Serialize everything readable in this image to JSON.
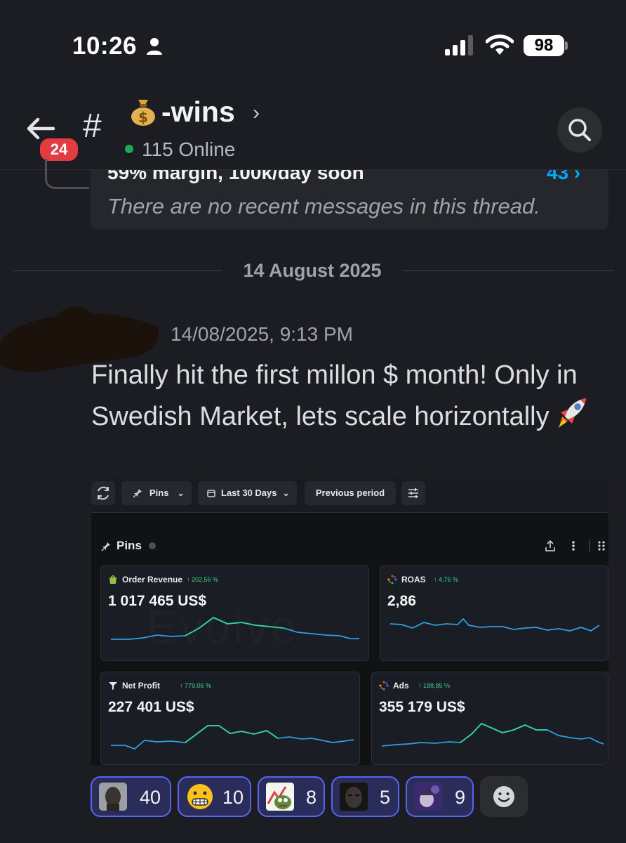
{
  "status_bar": {
    "time": "10:26",
    "battery": "98"
  },
  "header": {
    "back_badge": "24",
    "hash": "#",
    "channel_name": "-wins",
    "online": "115 Online"
  },
  "thread": {
    "title": "59% margin, 100k/day soon",
    "count": "43 ›",
    "empty_text": "There are no recent messages in this thread."
  },
  "date_divider": "14 August 2025",
  "message": {
    "timestamp": "14/08/2025, 9:13 PM",
    "text": "Finally hit the first millon $ month! Only in Swedish Market, lets scale horizontally"
  },
  "dashboard": {
    "toolbar": {
      "pins": "Pins",
      "range": "Last 30 Days",
      "compare": "Previous period"
    },
    "section_title": "Pins",
    "watermark": "Evolve",
    "cards": [
      {
        "title": "Order Revenue",
        "change": "↑ 202,56 %",
        "value": "1 017 465 US$"
      },
      {
        "title": "ROAS",
        "change": "↑ 4,76 %",
        "value": "2,86"
      },
      {
        "title": "Net Profit",
        "change": "↑ 779,06 %",
        "value": "227 401 US$"
      },
      {
        "title": "Ads",
        "change": "↑ 188,85 %",
        "value": "355 179 US$"
      }
    ]
  },
  "reactions": [
    {
      "count": "40",
      "icon": "avatar-face-icon"
    },
    {
      "count": "10",
      "icon": "grimace-emoji-icon"
    },
    {
      "count": "8",
      "icon": "pepe-chart-icon"
    },
    {
      "count": "5",
      "icon": "dark-face-icon"
    },
    {
      "count": "9",
      "icon": "anime-face-icon"
    }
  ],
  "colors": {
    "background": "#1c1d22",
    "accent_blue": "#00a8fc",
    "online_green": "#23a55a",
    "badge_red": "#e23b41",
    "reaction_border": "#5865f2",
    "spark_blue": "#2f9fe0",
    "spark_green": "#34d399"
  }
}
